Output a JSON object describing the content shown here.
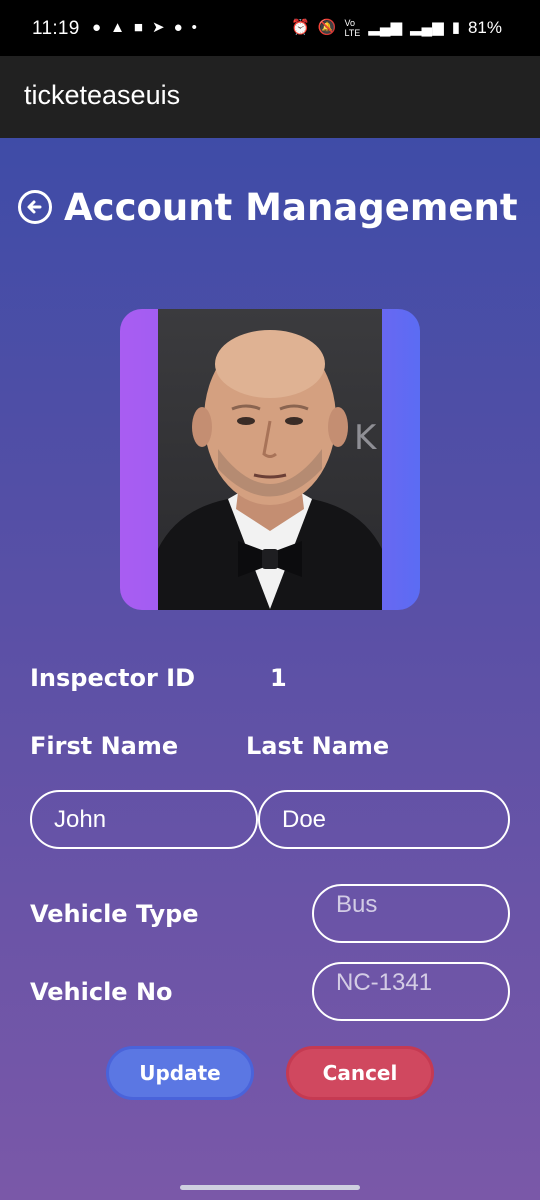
{
  "status_bar": {
    "time": "11:19",
    "battery": "81%",
    "network_label": "VoLTE 4G"
  },
  "app_bar": {
    "title": "ticketeaseuis"
  },
  "page": {
    "title": "Account Management",
    "back_icon": "arrow-left-circle-icon"
  },
  "profile": {
    "inspector_id_label": "Inspector ID",
    "inspector_id_value": "1",
    "first_name_label": "First Name",
    "last_name_label": "Last Name",
    "first_name_value": "John",
    "last_name_value": "Doe",
    "vehicle_type_label": "Vehicle Type",
    "vehicle_type_placeholder": "Bus",
    "vehicle_no_label": "Vehicle No",
    "vehicle_no_placeholder": "NC-1341"
  },
  "actions": {
    "update_label": "Update",
    "cancel_label": "Cancel"
  },
  "colors": {
    "gradient_top": "#3f4ca7",
    "gradient_bottom": "#7a58a8",
    "update_button": "#5b77e3",
    "cancel_button": "#d0485f",
    "app_bar": "#212121"
  }
}
